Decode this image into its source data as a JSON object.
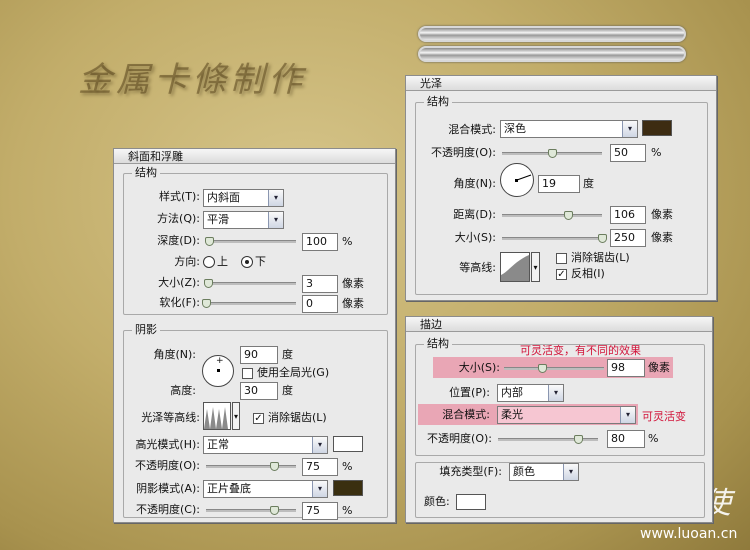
{
  "decor": {
    "title_art": "金属卡條制作",
    "watermark_cn": "落岸天使",
    "watermark_url": "www.luoan.cn"
  },
  "bevel": {
    "title": "斜面和浮雕",
    "group": "结构",
    "style_label": "样式(T):",
    "style_value": "内斜面",
    "method_label": "方法(Q):",
    "method_value": "平滑",
    "depth_label": "深度(D):",
    "depth_value": "100",
    "depth_unit": "%",
    "depth_level": 0.03,
    "direction_label": "方向:",
    "up_label": "上",
    "down_label": "下",
    "size_label": "大小(Z):",
    "size_value": "3",
    "size_unit": "像素",
    "size_level": 0.02,
    "soften_label": "软化(F):",
    "soften_value": "0",
    "soften_unit": "像素",
    "soften_level": 0.0
  },
  "shading": {
    "group": "阴影",
    "angle_label": "角度(N):",
    "angle_value": "90",
    "angle_unit": "度",
    "global_light_label": "使用全局光(G)",
    "altitude_label": "高度:",
    "altitude_value": "30",
    "altitude_unit": "度",
    "gloss_contour_label": "光泽等高线:",
    "antialias_label": "消除锯齿(L)",
    "highlight_mode_label": "高光模式(H):",
    "highlight_mode_value": "正常",
    "highlight_color": "#ffffff",
    "highlight_opacity_label": "不透明度(O):",
    "highlight_opacity_value": "75",
    "highlight_opacity_unit": "%",
    "highlight_opacity_level": 0.75,
    "shadow_mode_label": "阴影模式(A):",
    "shadow_mode_value": "正片叠底",
    "shadow_color": "#3a2f10",
    "shadow_opacity_label": "不透明度(C):",
    "shadow_opacity_value": "75",
    "shadow_opacity_unit": "%",
    "shadow_opacity_level": 0.75
  },
  "satin": {
    "title": "光泽",
    "group": "结构",
    "blend_label": "混合模式:",
    "blend_value": "深色",
    "color": "#3d2c12",
    "opacity_label": "不透明度(O):",
    "opacity_value": "50",
    "opacity_unit": "%",
    "opacity_level": 0.5,
    "angle_label": "角度(N):",
    "angle_value": "19",
    "angle_unit": "度",
    "distance_label": "距离(D):",
    "distance_value": "106",
    "distance_unit": "像素",
    "distance_level": 0.5,
    "size_label": "大小(S):",
    "size_value": "250",
    "size_unit": "像素",
    "size_level": 1.0,
    "contour_label": "等高线:",
    "antialias_label": "消除锯齿(L)",
    "invert_label": "反相(I)"
  },
  "stroke": {
    "title": "描边",
    "group": "结构",
    "annotation_size": "可灵活变，有不同的效果",
    "size_label": "大小(S):",
    "size_value": "98",
    "size_unit": "像素",
    "size_level": 0.38,
    "position_label": "位置(P):",
    "position_value": "内部",
    "blend_label": "混合模式:",
    "blend_value": "柔光",
    "annotation_blend": "可灵活变",
    "opacity_label": "不透明度(O):",
    "opacity_value": "80",
    "opacity_unit": "%",
    "opacity_level": 0.8,
    "fill_type_label": "填充类型(F):",
    "fill_type_value": "颜色",
    "color_label": "颜色:",
    "color": "#ffffff"
  },
  "icons": {
    "dropdown": "▾",
    "check": "✓"
  }
}
